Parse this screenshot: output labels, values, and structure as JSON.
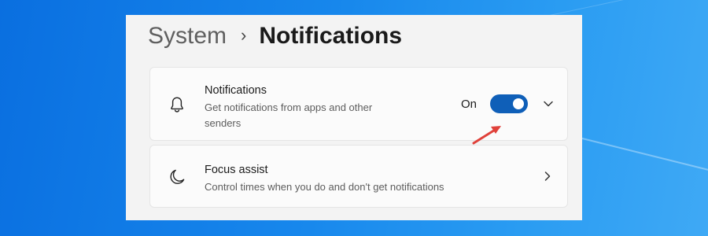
{
  "breadcrumb": {
    "parent": "System",
    "separator": "›",
    "current": "Notifications"
  },
  "notifications_card": {
    "icon": "bell-icon",
    "title": "Notifications",
    "description": "Get notifications from apps and other senders",
    "toggle_state_label": "On",
    "toggle_on": true,
    "expand_icon": "chevron-down-icon"
  },
  "focus_assist_card": {
    "icon": "moon-icon",
    "title": "Focus assist",
    "description": "Control times when you do and don't get notifications",
    "navigate_icon": "chevron-right-icon"
  },
  "colors": {
    "accent": "#0f5fb8",
    "annotation_arrow": "#e0413a",
    "desktop_background": "#1787ec",
    "panel_background": "#f3f3f3"
  }
}
